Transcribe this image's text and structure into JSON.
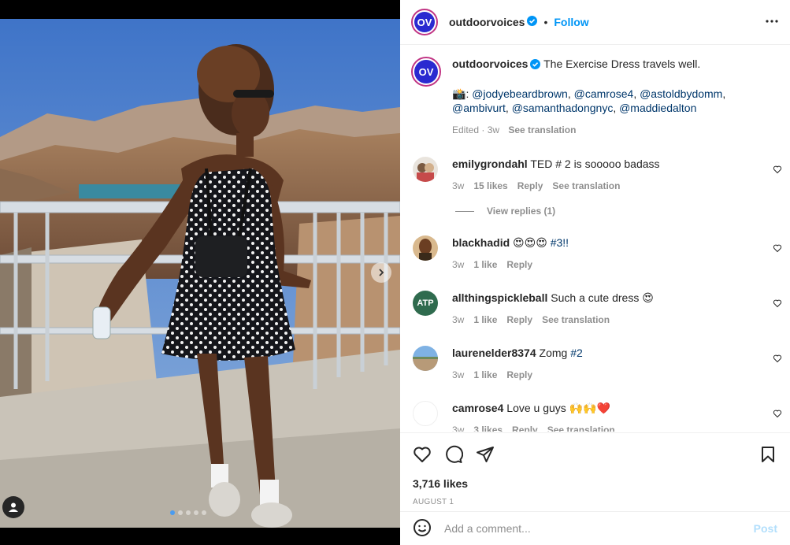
{
  "post": {
    "account": {
      "username": "outdoorvoices",
      "avatar_text": "OV",
      "follow_label": "Follow",
      "separator": "•"
    },
    "caption": {
      "text": "The Exercise Dress travels well.",
      "camera_emoji": "📸",
      "mentions": [
        "@jodyebeardbrown",
        "@camrose4",
        "@astoldbydomm",
        "@ambivurt",
        "@samanthadongnyc",
        "@maddiedalton"
      ],
      "edited": "Edited · 3w",
      "see_translation": "See translation"
    },
    "comments": [
      {
        "username": "emilygrondahl",
        "text": "TED # 2 is sooooo badass",
        "time": "3w",
        "likes": "15 likes",
        "reply": "Reply",
        "translation": "See translation",
        "view_replies": "View replies (1)"
      },
      {
        "username": "blackhadid",
        "emojis": "😍😍😍",
        "hashtag": "#3!!",
        "time": "3w",
        "likes": "1 like",
        "reply": "Reply"
      },
      {
        "username": "allthingspickleball",
        "avatar_text": "ATP",
        "text": "Such a cute dress 😍",
        "time": "3w",
        "likes": "1 like",
        "reply": "Reply",
        "translation": "See translation"
      },
      {
        "username": "laurenelder8374",
        "text": "Zomg",
        "hashtag": "#2",
        "time": "3w",
        "likes": "1 like",
        "reply": "Reply"
      },
      {
        "username": "camrose4",
        "text": "Love u guys 🙌🙌❤️",
        "time": "3w",
        "likes": "3 likes",
        "reply": "Reply",
        "translation": "See translation"
      }
    ],
    "likes_count": "3,716 likes",
    "date": "AUGUST 1",
    "comment_input": {
      "placeholder": "Add a comment...",
      "post_label": "Post"
    }
  },
  "colors": {
    "accent": "#0095f6",
    "brand_avatar": "#2a2ad0",
    "text": "#262626",
    "muted": "#8e8e8e",
    "link": "#00376b"
  },
  "icons": [
    "verified-icon",
    "more-options-icon",
    "heart-icon",
    "comment-icon",
    "share-icon",
    "save-icon",
    "emoji-icon",
    "user-tag-icon",
    "next-arrow-icon"
  ]
}
